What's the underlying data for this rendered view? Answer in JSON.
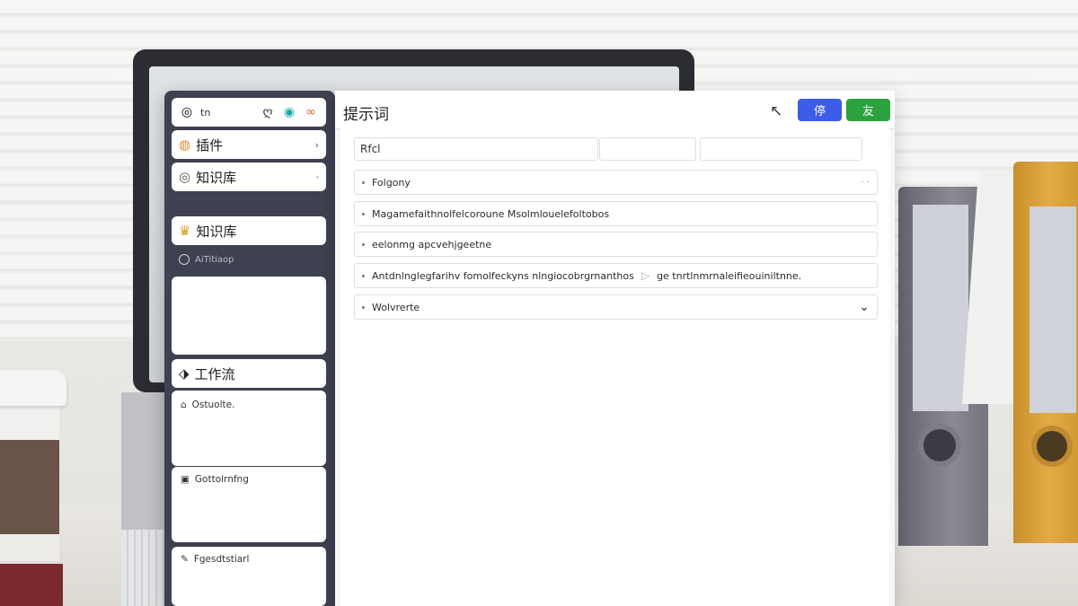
{
  "app": {
    "title": "提示词"
  },
  "sidebar": {
    "topbar": {
      "text": "tn",
      "icons": [
        "spiral-icon",
        "brain-icon",
        "teal-badge-icon",
        "orange-link-icon"
      ]
    },
    "items": [
      {
        "label": "插件",
        "icon": "plugin-icon"
      },
      {
        "label": "知识库",
        "icon": "database-icon"
      },
      {
        "label": "知识库",
        "icon": "lightbulb-icon"
      },
      {
        "label": "工作流",
        "icon": "workflow-icon"
      }
    ],
    "sub_item": "AiTitiaop",
    "panels": [
      {
        "label": "Ostuolte.",
        "icon": "chat-icon"
      },
      {
        "label": "Gottolrnfng",
        "icon": "calendar-icon"
      },
      {
        "label": "Fgesdtstiarl",
        "icon": "pen-icon"
      }
    ]
  },
  "header": {
    "btn_primary": "停",
    "btn_success": "友"
  },
  "form": {
    "field1": "Rfcl",
    "field2": "",
    "field3": "",
    "rows": [
      {
        "text": "Folgony",
        "end": "· ·"
      },
      {
        "text": "Magamefaithnolfelcoroune Msolmlouelefoltobos"
      },
      {
        "text": "eelonmg apcvehjgeetne"
      },
      {
        "text": "Antdnlnglegfarihv fomolfeckyns nlngiocobrgrnanthos",
        "extra": "ge tnrtlnmrnaleifieouiniltnne."
      },
      {
        "text": "Wolvrerte"
      }
    ]
  },
  "colors": {
    "primary": "#3d5ce8",
    "success": "#2ca23f",
    "sidebar": "#3d4150"
  }
}
